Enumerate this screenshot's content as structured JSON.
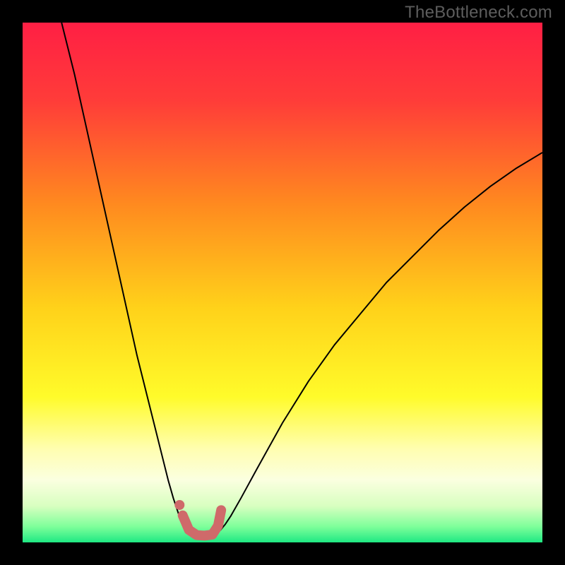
{
  "watermark": "TheBottleneck.com",
  "chart_data": {
    "type": "line",
    "title": "",
    "xlabel": "",
    "ylabel": "",
    "xlim": [
      0,
      100
    ],
    "ylim": [
      0,
      100
    ],
    "grid": false,
    "legend": false,
    "gradient_stops": [
      {
        "offset": 0.0,
        "color": "#ff1f44"
      },
      {
        "offset": 0.15,
        "color": "#ff3c39"
      },
      {
        "offset": 0.35,
        "color": "#ff8a1f"
      },
      {
        "offset": 0.55,
        "color": "#ffd21a"
      },
      {
        "offset": 0.72,
        "color": "#fffb2a"
      },
      {
        "offset": 0.82,
        "color": "#fffeb0"
      },
      {
        "offset": 0.88,
        "color": "#fbffe0"
      },
      {
        "offset": 0.93,
        "color": "#d8ffc0"
      },
      {
        "offset": 0.97,
        "color": "#7dff9a"
      },
      {
        "offset": 1.0,
        "color": "#1fe883"
      }
    ],
    "series": [
      {
        "name": "curve-left",
        "stroke": "#000000",
        "stroke_width": 2,
        "x": [
          7.5,
          10,
          12,
          14,
          16,
          18,
          20,
          22,
          24,
          26,
          28,
          29,
          30,
          31,
          32
        ],
        "y": [
          100,
          90,
          81,
          72,
          63,
          54,
          45,
          36,
          28,
          20,
          12,
          8.5,
          5.5,
          3.5,
          2.3
        ]
      },
      {
        "name": "curve-right",
        "stroke": "#000000",
        "stroke_width": 2,
        "x": [
          38,
          39,
          40,
          42,
          45,
          50,
          55,
          60,
          65,
          70,
          75,
          80,
          85,
          90,
          95,
          100
        ],
        "y": [
          2.3,
          3.5,
          5.0,
          8.5,
          14,
          23,
          31,
          38,
          44,
          50,
          55,
          60,
          64.5,
          68.5,
          72,
          75
        ]
      },
      {
        "name": "marker-dot",
        "type": "scatter",
        "color": "#cf6a6a",
        "radius": 7,
        "x": [
          30.2
        ],
        "y": [
          7.2
        ]
      },
      {
        "name": "flat-segment",
        "stroke": "#cf6a6a",
        "stroke_width": 14,
        "linecap": "round",
        "x": [
          30.8,
          32,
          33.5,
          35,
          36.5,
          37.6,
          38.2
        ],
        "y": [
          5.2,
          2.4,
          1.4,
          1.3,
          1.5,
          3.2,
          6.2
        ]
      }
    ]
  }
}
